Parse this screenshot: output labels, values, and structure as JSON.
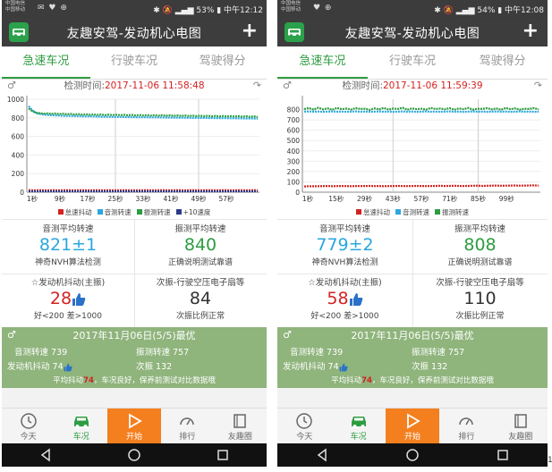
{
  "phones": [
    {
      "status": {
        "carrier_top": "中国电信",
        "carrier_bottom": "中国移动",
        "right": "✱ 🔕 ▂▄▆ 53% ▮ 中午12:12"
      },
      "title": "友趣安驾-发动机心电图",
      "plus": "+",
      "tabs": [
        "急速车况",
        "行驶车况",
        "驾驶得分"
      ],
      "time_label": "检测时间:",
      "time_value": "2017-11-06 11:58:48",
      "chart_data": {
        "type": "line",
        "ylim": [
          0,
          1000
        ],
        "yticks": [
          "1000",
          "800",
          "600",
          "400",
          "200",
          "0"
        ],
        "xticks": [
          "1秒",
          "9秒",
          "17秒",
          "25秒",
          "33秒",
          "41秒",
          "49秒",
          "57秒"
        ],
        "series": [
          {
            "name": "怠速抖动",
            "color": "#d32222",
            "values": [
              22,
              21,
              20,
              22,
              21,
              20,
              21,
              22,
              20,
              21,
              22,
              21,
              20,
              21,
              22,
              21,
              20,
              21,
              22,
              20,
              21,
              22,
              21,
              20,
              21,
              22,
              21,
              20,
              21,
              20,
              21,
              22,
              21,
              20,
              21,
              22,
              21,
              20,
              21,
              22,
              21,
              20,
              21,
              22,
              21,
              20,
              21,
              22,
              21,
              20,
              21,
              22,
              21,
              20,
              21,
              22,
              21,
              20,
              21,
              22,
              21
            ]
          },
          {
            "name": "音测转速",
            "color": "#29a7de",
            "values": [
              925,
              880,
              850,
              840,
              835,
              830,
              828,
              826,
              824,
              822,
              820,
              820,
              818,
              818,
              816,
              815,
              815,
              814,
              813,
              812,
              812,
              811,
              810,
              810,
              810,
              809,
              808,
              808,
              807,
              806,
              806,
              806,
              805,
              805,
              805,
              804,
              803,
              803,
              802,
              802,
              801,
              801,
              800,
              800,
              800,
              799,
              799,
              798,
              798,
              797,
              797,
              796,
              796,
              795,
              795,
              794,
              794,
              793,
              793,
              792,
              792
            ]
          },
          {
            "name": "振测转速",
            "color": "#2e9d41",
            "values": [
              900,
              870,
              855,
              850,
              845,
              848,
              842,
              846,
              840,
              844,
              838,
              842,
              836,
              840,
              835,
              838,
              833,
              837,
              832,
              836,
              830,
              835,
              829,
              834,
              828,
              833,
              827,
              832,
              826,
              831,
              825,
              830,
              824,
              829,
              823,
              828,
              822,
              827,
              821,
              826,
              820,
              825,
              819,
              824,
              818,
              823,
              817,
              822,
              816,
              821,
              815,
              820,
              814,
              819,
              813,
              818,
              812,
              817,
              811,
              816,
              810
            ]
          },
          {
            "name": "+10速度",
            "color": "#2b3a8a",
            "values": [
              10,
              10,
              10,
              10,
              10,
              10,
              10,
              10,
              10,
              10,
              10,
              10,
              10,
              10,
              10,
              10,
              10,
              10,
              10,
              10,
              10,
              10,
              10,
              10,
              10,
              10,
              10,
              10,
              10,
              10,
              10,
              10,
              10,
              10,
              10,
              10,
              10,
              10,
              10,
              10,
              10,
              10,
              10,
              10,
              10,
              10,
              10,
              10,
              10,
              10,
              10,
              10,
              10,
              10,
              10,
              10,
              10,
              10,
              10,
              10,
              10
            ]
          }
        ]
      },
      "stats": {
        "audio_label": "音测平均转速",
        "audio_value": "821±1",
        "audio_sub": "神奇NVH算法检测",
        "vib_label": "振测平均转速",
        "vib_value": "840",
        "vib_sub": "正确说明测试靠谱",
        "shake_label": "☆发动机抖动(主振)",
        "shake_value": "28",
        "shake_sub": "好<200 差>1000",
        "sec_label": "次振-行驶空压电子扇等",
        "sec_value": "84",
        "sec_sub": "次振比例正常"
      },
      "summary": {
        "header": "2017年11月06日(5/5)最优",
        "audio_label": "音测转速",
        "audio_value": "739",
        "vib_label": "振测转速",
        "vib_value": "757",
        "shake_label": "发动机抖动",
        "shake_value": "74",
        "sec_label": "次振",
        "sec_value": "132",
        "note_a": "平均抖动",
        "note_b": "74",
        "note_c": "，车况良好，保养前测试对比数据哦"
      },
      "nav": [
        "今天",
        "车况",
        "开始",
        "排行",
        "友趣圈"
      ]
    },
    {
      "status": {
        "carrier_top": "中国电信",
        "carrier_bottom": "中国移动",
        "right": "✱ 🔕 ▂▄▆ 54% ▮ 中午12:08"
      },
      "title": "友趣安驾-发动机心电图",
      "plus": "+",
      "tabs": [
        "急速车况",
        "行驶车况",
        "驾驶得分"
      ],
      "time_label": "检测时间:",
      "time_value": "2017-11-06 11:59:39",
      "chart_data": {
        "type": "line",
        "ylim": [
          0,
          900
        ],
        "yticks": [
          "800",
          "700",
          "600",
          "500",
          "400",
          "300",
          "200",
          "100",
          "0"
        ],
        "xticks": [
          "1秒",
          "15秒",
          "29秒",
          "43秒",
          "57秒",
          "71秒",
          "85秒",
          "99秒"
        ],
        "series": [
          {
            "name": "怠速抖动",
            "color": "#d32222",
            "values": [
              55,
              58,
              57,
              58,
              59,
              60,
              58,
              59,
              60,
              59,
              58,
              60,
              59,
              60,
              61,
              59,
              60,
              58,
              59,
              60,
              61,
              60,
              59,
              60,
              61,
              60,
              59,
              60,
              61,
              62,
              60,
              61,
              62,
              61,
              60,
              61,
              62,
              63,
              61,
              62,
              63,
              64,
              62,
              63,
              64,
              65,
              63,
              64,
              65,
              66,
              64
            ]
          },
          {
            "name": "音测转速",
            "color": "#29a7de",
            "values": [
              780,
              782,
              779,
              781,
              778,
              780,
              782,
              779,
              781,
              778,
              780,
              782,
              779,
              781,
              778,
              780,
              782,
              779,
              781,
              778,
              780,
              782,
              779,
              781,
              778,
              780,
              782,
              779,
              781,
              778,
              780,
              782,
              779,
              781,
              778,
              780,
              782,
              779,
              781,
              778,
              780,
              782,
              779,
              781,
              778,
              780,
              782,
              779,
              781,
              778,
              780
            ]
          },
          {
            "name": "振测转速",
            "color": "#2e9d41",
            "values": [
              805,
              815,
              800,
              818,
              802,
              812,
              798,
              816,
              804,
              810,
              800,
              814,
              806,
              808,
              796,
              812,
              802,
              816,
              800,
              810,
              806,
              818,
              798,
              812,
              804,
              808,
              800,
              816,
              806,
              810,
              802,
              814,
              798,
              812,
              804,
              816,
              800,
              808,
              806,
              814,
              802,
              810,
              798,
              816,
              804,
              812,
              800,
              808,
              806,
              814,
              802
            ]
          }
        ]
      },
      "stats": {
        "audio_label": "音测平均转速",
        "audio_value": "779±2",
        "audio_sub": "神奇NVH算法检测",
        "vib_label": "振测平均转速",
        "vib_value": "808",
        "vib_sub": "正确说明测试靠谱",
        "shake_label": "☆发动机抖动(主振)",
        "shake_value": "58",
        "shake_sub": "好<200 差>1000",
        "sec_label": "次振-行驶空压电子扇等",
        "sec_value": "110",
        "sec_sub": "次振比例正常"
      },
      "summary": {
        "header": "2017年11月06日(5/5)最优",
        "audio_label": "音测转速",
        "audio_value": "739",
        "vib_label": "振测转速",
        "vib_value": "757",
        "shake_label": "发动机抖动",
        "shake_value": "74",
        "sec_label": "次振",
        "sec_value": "132",
        "note_a": "平均抖动",
        "note_b": "74",
        "note_c": "，车况良好，保养前测试对比数据哦"
      },
      "nav": [
        "今天",
        "车况",
        "开始",
        "排行",
        "友趣圈"
      ]
    }
  ],
  "colors": {
    "accent": "#2e9d41",
    "start": "#f47f1f",
    "summary_bg": "#8fb47c",
    "red": "#d32222",
    "blue": "#29a7de"
  },
  "footer_mark": "1"
}
